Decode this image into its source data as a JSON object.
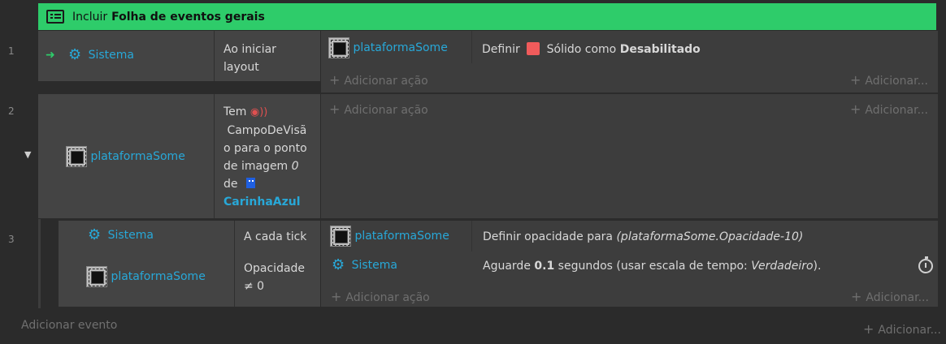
{
  "include": {
    "prefix": "Incluir",
    "sheet_name": "Folha de eventos gerais"
  },
  "add_action": "Adicionar ação",
  "add_short": "Adicionar...",
  "add_event": "Adicionar evento",
  "events": [
    {
      "number": "1",
      "condition_object": "Sistema",
      "condition_text_l1": "Ao iniciar",
      "condition_text_l2": "layout",
      "action_object": "plataformaSome",
      "action_prefix": "Definir",
      "action_middle": "Sólido como",
      "action_value": "Desabilitado"
    },
    {
      "number": "2",
      "condition_object": "plataformaSome",
      "cond_l1": "Tem",
      "cond_l2": "CampoDeVisã",
      "cond_l3": "o para o ponto",
      "cond_l4_a": "de imagem",
      "cond_l4_b": "0",
      "cond_l5": "de",
      "cond_l6": "CarinhaAzul"
    },
    {
      "number": "3",
      "condition1_object": "Sistema",
      "condition1_text": "A cada tick",
      "condition2_object": "plataformaSome",
      "condition2_l1": "Opacidade",
      "condition2_l2": "≠ 0",
      "action1_object": "plataformaSome",
      "action1_prefix": "Definir opacidade para",
      "action1_expr": "(plataformaSome.Opacidade-10)",
      "action2_object": "Sistema",
      "action2_a": "Aguarde",
      "action2_b": "0.1",
      "action2_c": "segundos (usar escala de tempo:",
      "action2_d": "Verdadeiro",
      "action2_e": ")."
    }
  ]
}
